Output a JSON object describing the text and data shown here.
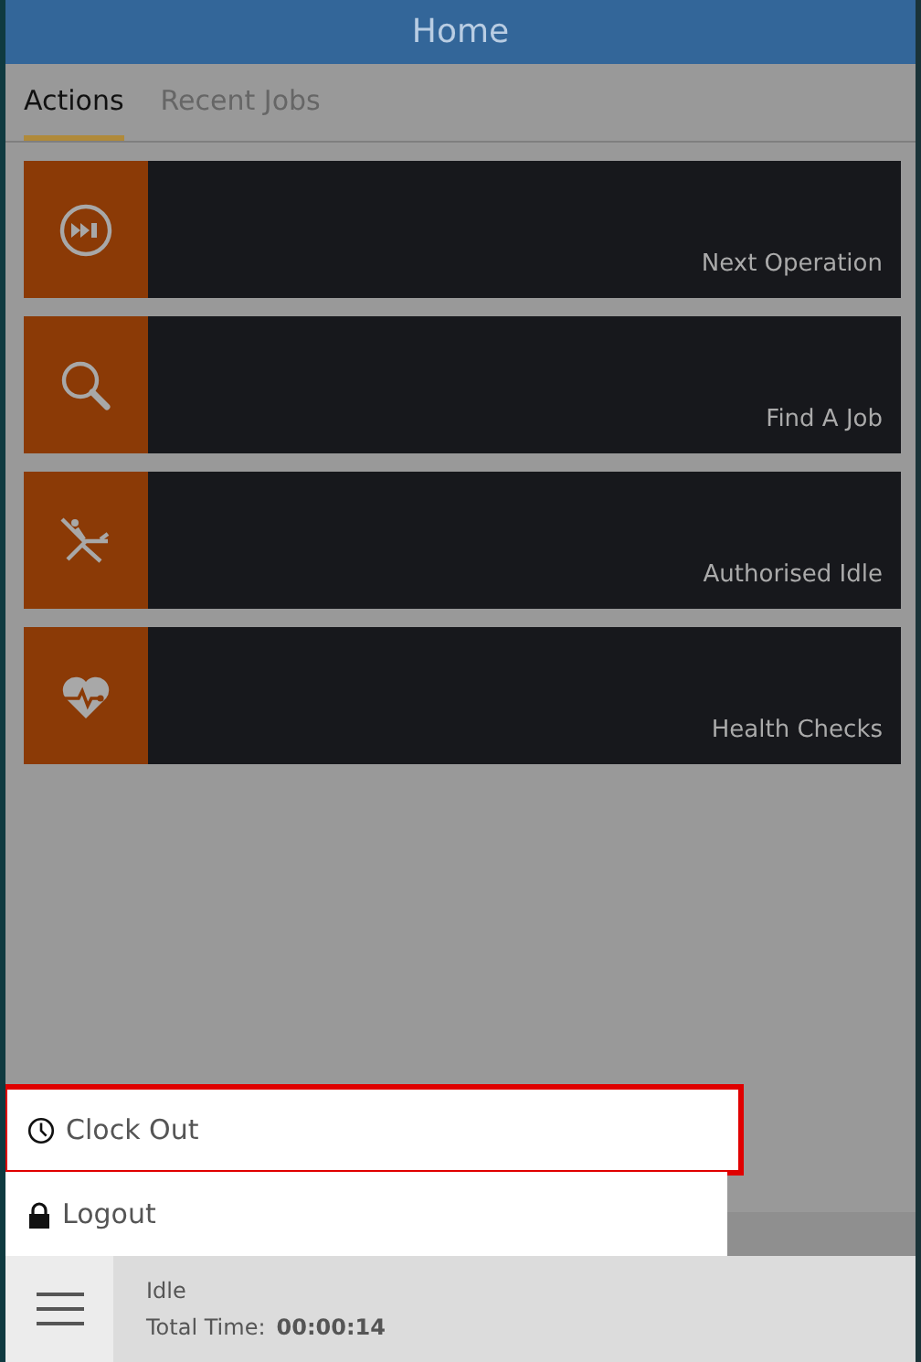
{
  "header": {
    "title": "Home"
  },
  "tabs": [
    {
      "label": "Actions",
      "selected": true
    },
    {
      "label": "Recent Jobs",
      "selected": false
    }
  ],
  "tiles": [
    {
      "label": "Next Operation",
      "kind": "skip"
    },
    {
      "label": "Find A Job",
      "kind": "search"
    },
    {
      "label": "Authorised Idle",
      "kind": "lounger"
    },
    {
      "label": "Health Checks",
      "kind": "heart"
    }
  ],
  "menu": [
    {
      "label": "Clock Out",
      "kind": "clock",
      "highlighted": true
    },
    {
      "label": "Logout",
      "kind": "lock",
      "highlighted": false
    }
  ],
  "status_bar": {
    "state": "Idle",
    "total_label": "Total Time:",
    "total_value": "00:00:14"
  }
}
